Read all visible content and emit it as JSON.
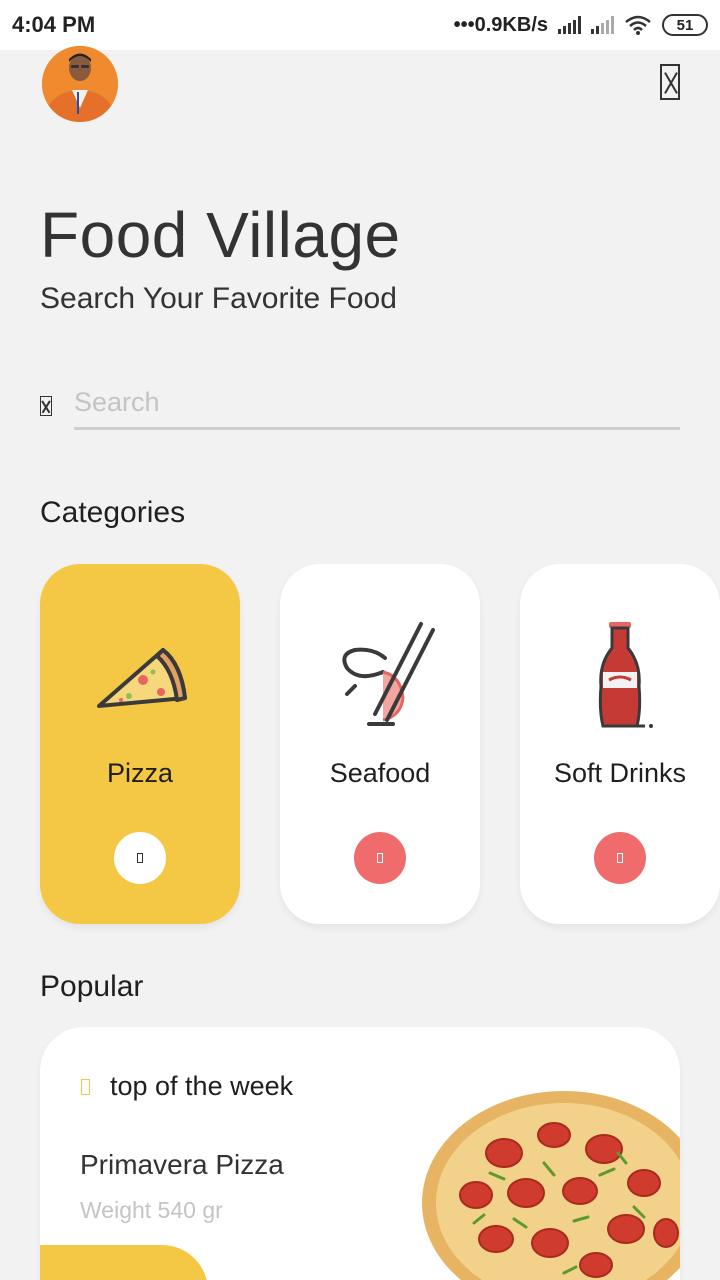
{
  "status_bar": {
    "time": "4:04 PM",
    "network_speed": "•••0.9KB/s",
    "battery": "51"
  },
  "header": {
    "avatar": "profile-avatar",
    "menu_icon": "menu-icon"
  },
  "hero": {
    "title": "Food Village",
    "subtitle": "Search Your Favorite Food"
  },
  "search": {
    "placeholder": "Search",
    "value": "",
    "icon": "search-icon"
  },
  "categories": {
    "title": "Categories",
    "items": [
      {
        "label": "Pizza",
        "icon": "pizza-slice-icon",
        "selected": true
      },
      {
        "label": "Seafood",
        "icon": "shrimp-chopsticks-icon",
        "selected": false
      },
      {
        "label": "Soft Drinks",
        "icon": "soda-bottle-icon",
        "selected": false
      }
    ]
  },
  "popular": {
    "title": "Popular",
    "card": {
      "badge": "top of the week",
      "name": "Primavera Pizza",
      "weight": "Weight 540 gr",
      "image": "pizza-photo"
    }
  },
  "colors": {
    "accent_yellow": "#f4c845",
    "accent_red": "#f06b6b",
    "background": "#f2f2f2",
    "card": "#ffffff"
  }
}
